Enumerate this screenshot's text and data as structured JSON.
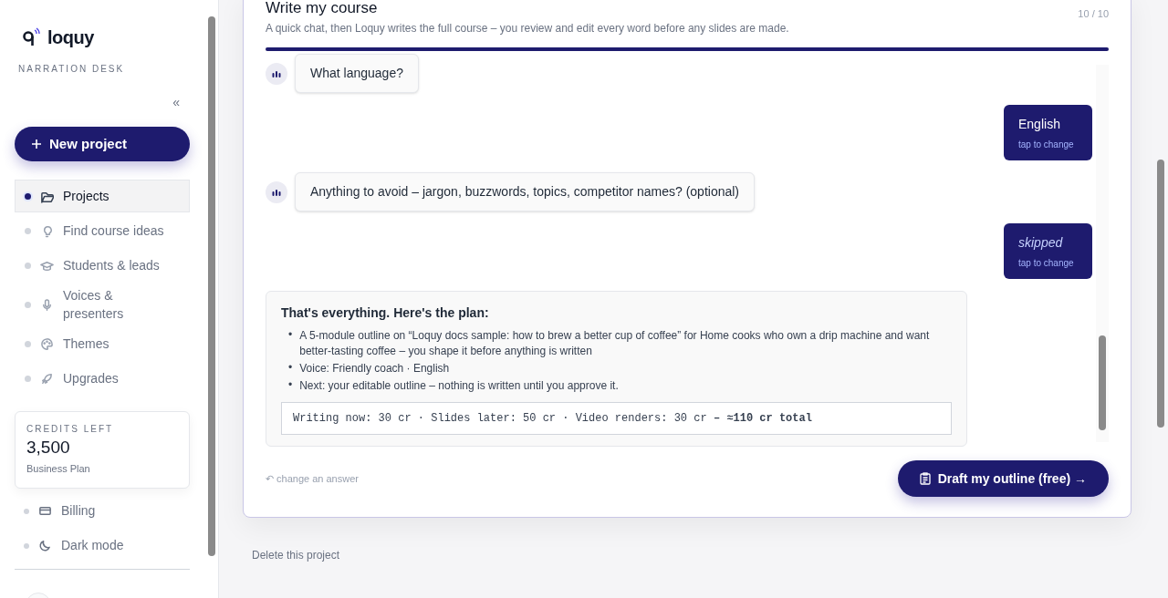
{
  "sidebar": {
    "logo": "loquy",
    "tagline": "NARRATION DESK",
    "collapse": "«",
    "new_project": "New project",
    "nav": [
      {
        "label": "Projects",
        "selected": true
      },
      {
        "label": "Find course ideas",
        "selected": false
      },
      {
        "label": "Students & leads",
        "selected": false
      },
      {
        "label": "Voices & presenters",
        "selected": false
      },
      {
        "label": "Themes",
        "selected": false
      },
      {
        "label": "Upgrades",
        "selected": false
      }
    ],
    "credits": {
      "label": "CREDITS LEFT",
      "amount": "3,500",
      "plan": "Business Plan"
    },
    "bottom_nav": [
      {
        "label": "Billing"
      },
      {
        "label": "Dark mode"
      }
    ]
  },
  "main": {
    "title": "Write my course",
    "subtitle": "A quick chat, then Loquy writes the full course – you review and edit every word before any slides are made.",
    "step": "10 / 10",
    "level": 1,
    "messages": [
      {
        "kind": "bot",
        "text": "What language?"
      },
      {
        "kind": "user",
        "text": "English",
        "skipped": false,
        "hint": "tap to change"
      },
      {
        "kind": "bot",
        "text": "Anything to avoid – jargon, buzzwords, topics, competitor names? (optional)"
      },
      {
        "kind": "user",
        "text": "skipped",
        "skipped": true,
        "hint": "tap to change"
      }
    ],
    "plan": {
      "title": "That's everything. Here's the plan:",
      "bullets": [
        {
          "marker": "•",
          "text": "A 5-module outline on “Loquy docs sample: how to brew a better cup of coffee” for Home cooks who own a drip machine and want better-tasting coffee – you shape it before anything is written"
        },
        {
          "marker": "•",
          "text": "Voice: Friendly coach · English"
        },
        {
          "marker": "•",
          "text": "Next: your editable outline – nothing is written until you approve it."
        }
      ],
      "cost": "Writing now: 30 cr · Slides later: 50 cr · Video renders: 30 cr **– ≈110 cr total**"
    },
    "change_link": "↶ change an answer",
    "draft_button": "Draft my outline (free) →",
    "delete_link": "Delete this project"
  }
}
